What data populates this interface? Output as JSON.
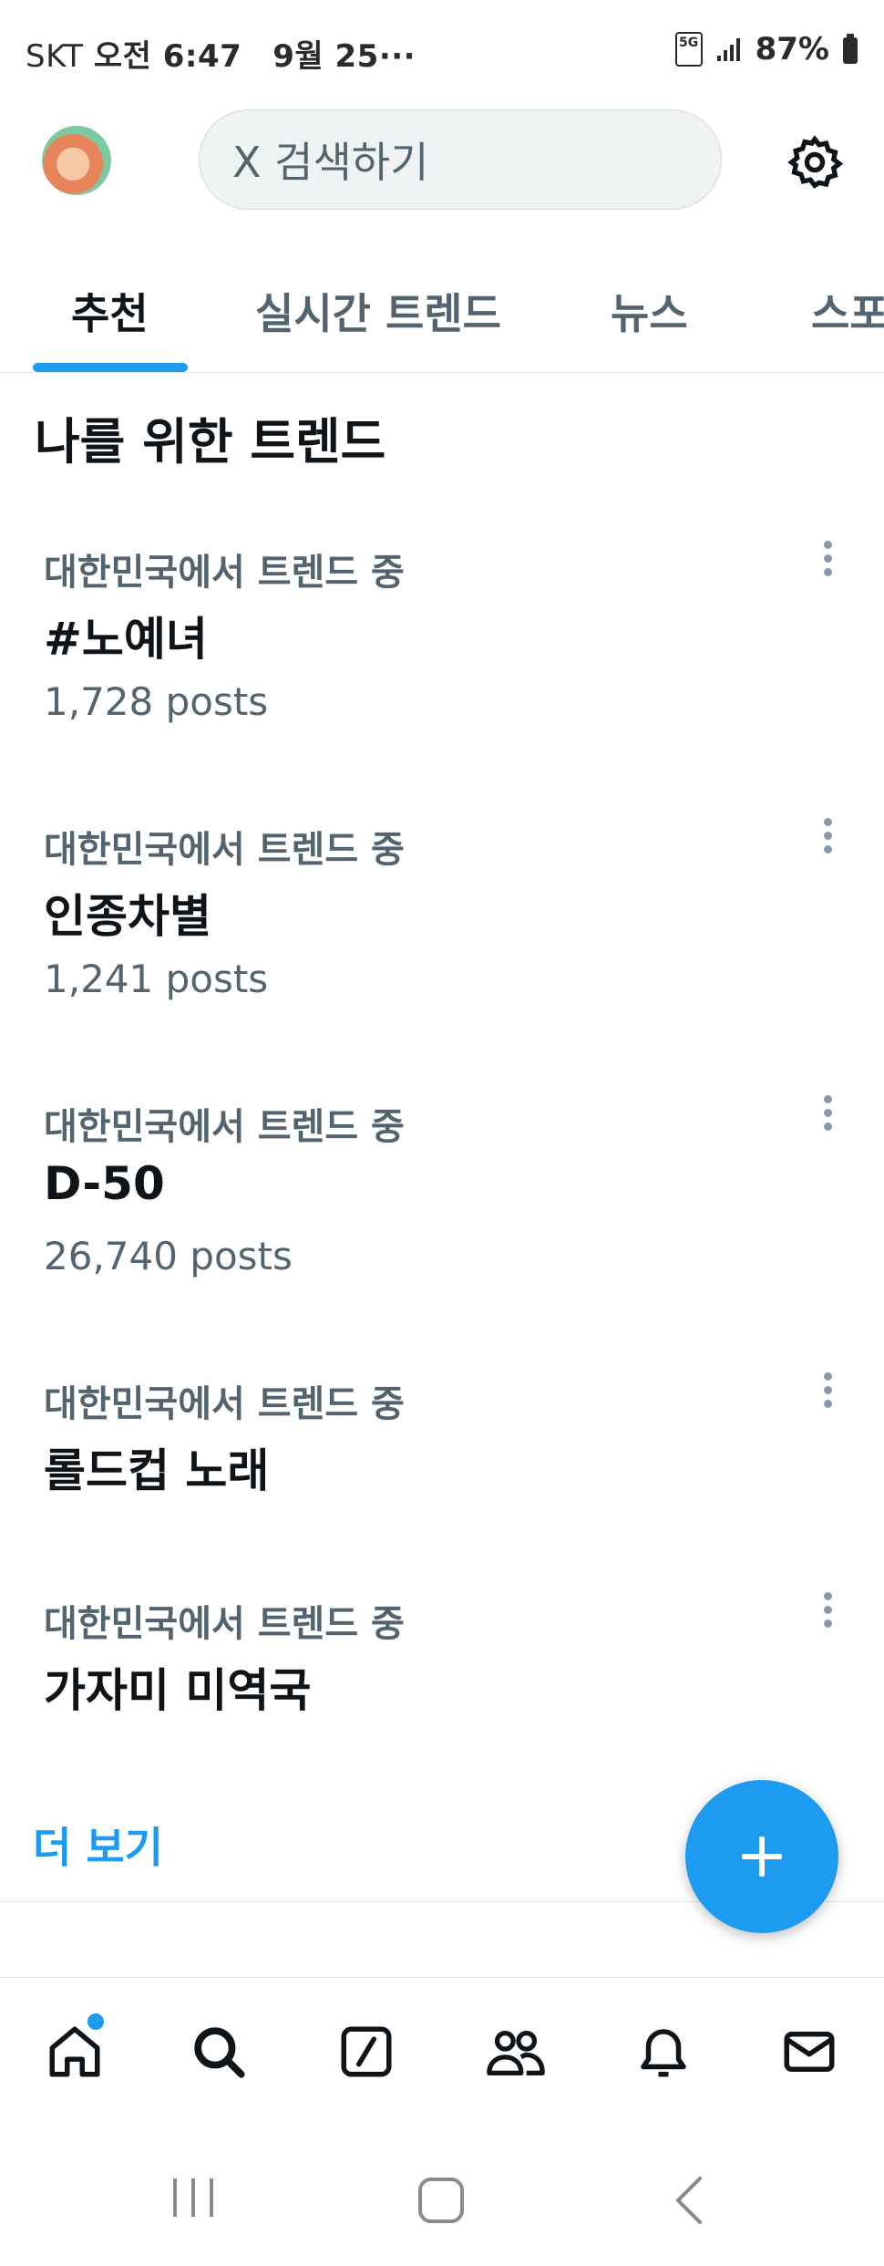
{
  "status_bar": {
    "carrier": "SKT",
    "time": "오전 6:47",
    "date": "9월 25···",
    "network": "5G",
    "battery": "87%"
  },
  "header": {
    "search_placeholder": "X 검색하기"
  },
  "tabs": [
    {
      "label": "추천",
      "active": true
    },
    {
      "label": "실시간 트렌드",
      "active": false
    },
    {
      "label": "뉴스",
      "active": false
    },
    {
      "label": "스포",
      "active": false
    }
  ],
  "section_title": "나를 위한 트렌드",
  "trends": [
    {
      "context": "대한민국에서 트렌드 중",
      "name": "#노예녀",
      "count": "1,728 posts"
    },
    {
      "context": "대한민국에서 트렌드 중",
      "name": "인종차별",
      "count": "1,241 posts"
    },
    {
      "context": "대한민국에서 트렌드 중",
      "name": "D-50",
      "count": "26,740 posts"
    },
    {
      "context": "대한민국에서 트렌드 중",
      "name": "롤드컵 노래",
      "count": ""
    },
    {
      "context": "대한민국에서 트렌드 중",
      "name": "가자미 미역국",
      "count": ""
    }
  ],
  "show_more": "더 보기",
  "colors": {
    "accent": "#1d9bf0",
    "secondary_text": "#536471",
    "primary_text": "#0f1419"
  },
  "icons": {
    "nav": [
      "home-icon",
      "search-icon",
      "grok-icon",
      "communities-icon",
      "bell-icon",
      "mail-icon"
    ],
    "system": [
      "recent-apps-icon",
      "home-button-icon",
      "back-icon"
    ]
  }
}
